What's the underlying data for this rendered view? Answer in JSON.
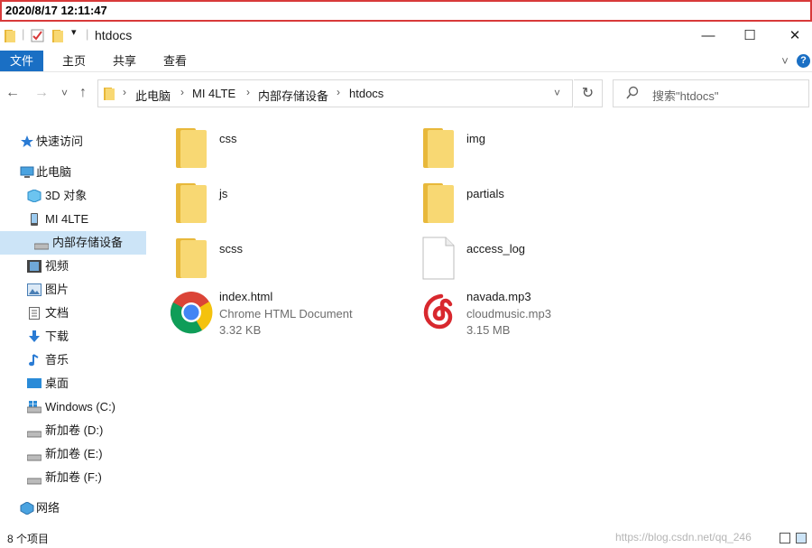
{
  "overlay": {
    "datetime": "2020/8/17 12:11:47"
  },
  "window": {
    "title": "htdocs",
    "minimize": "—",
    "maximize": "☐",
    "close": "✕"
  },
  "ribbon": {
    "tabs": [
      "文件",
      "主页",
      "共享",
      "查看"
    ],
    "expand": "˅",
    "help": "?"
  },
  "nav": {
    "back": "←",
    "forward": "→",
    "recent": "˅",
    "up": "↑",
    "dropdown": "˅",
    "refresh": "↻",
    "breadcrumb": [
      "此电脑",
      "MI 4LTE",
      "内部存储设备",
      "htdocs"
    ],
    "search_placeholder": "搜索\"htdocs\""
  },
  "sidebar": {
    "items": [
      {
        "label": "快速访问",
        "icon": "star-icon"
      },
      {
        "label": "此电脑",
        "icon": "computer-icon"
      },
      {
        "label": "3D 对象",
        "icon": "3d-objects-icon"
      },
      {
        "label": "MI 4LTE",
        "icon": "phone-icon"
      },
      {
        "label": "内部存储设备",
        "icon": "drive-icon"
      },
      {
        "label": "视频",
        "icon": "video-icon"
      },
      {
        "label": "图片",
        "icon": "picture-icon"
      },
      {
        "label": "文档",
        "icon": "document-icon"
      },
      {
        "label": "下载",
        "icon": "download-icon"
      },
      {
        "label": "音乐",
        "icon": "music-icon"
      },
      {
        "label": "桌面",
        "icon": "desktop-icon"
      },
      {
        "label": "Windows (C:)",
        "icon": "windows-drive-icon"
      },
      {
        "label": "新加卷 (D:)",
        "icon": "drive-icon"
      },
      {
        "label": "新加卷 (E:)",
        "icon": "drive-icon"
      },
      {
        "label": "新加卷 (F:)",
        "icon": "drive-icon"
      },
      {
        "label": "网络",
        "icon": "network-icon"
      }
    ]
  },
  "files": [
    {
      "name": "css",
      "type": "folder"
    },
    {
      "name": "img",
      "type": "folder"
    },
    {
      "name": "js",
      "type": "folder"
    },
    {
      "name": "partials",
      "type": "folder"
    },
    {
      "name": "scss",
      "type": "folder"
    },
    {
      "name": "access_log",
      "type": "file"
    },
    {
      "name": "index.html",
      "type": "chrome",
      "kind": "Chrome HTML Document",
      "size": "3.32 KB"
    },
    {
      "name": "navada.mp3",
      "type": "music",
      "kind": "cloudmusic.mp3",
      "size": "3.15 MB"
    }
  ],
  "status": {
    "count": "8 个项目",
    "watermark": "https://blog.csdn.net/qq_246"
  },
  "colors": {
    "accent": "#1a6fc4",
    "selection": "#cce4f7",
    "folder": "#f8d873",
    "folder_dark": "#e8b83a",
    "netease_red": "#d8282e"
  }
}
